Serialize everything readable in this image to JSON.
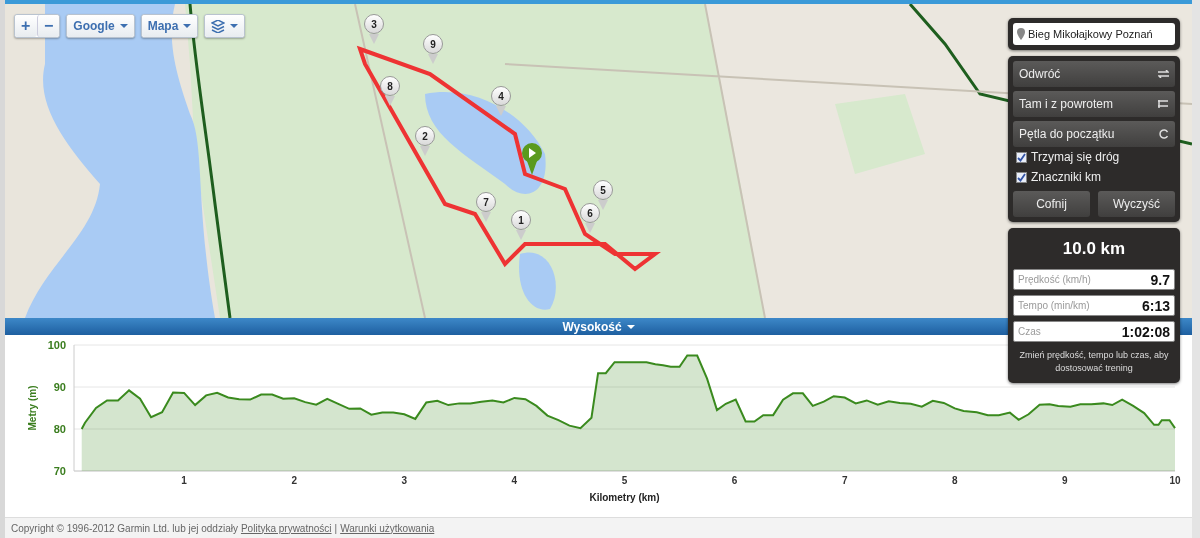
{
  "map": {
    "controls": [
      {
        "kind": "zoom",
        "labels": [
          "+",
          "−"
        ]
      },
      {
        "kind": "dropdown",
        "label": "Google"
      },
      {
        "kind": "dropdown",
        "label": "Mapa"
      },
      {
        "kind": "layers"
      }
    ],
    "km_markers": [
      "1",
      "2",
      "3",
      "4",
      "5",
      "6",
      "7",
      "8",
      "9"
    ],
    "route_panel": {
      "search": {
        "value": "Bieg Mikołajkowy Poznań"
      },
      "actions": [
        {
          "label": "Odwróć",
          "kind": "reverse"
        },
        {
          "label": "Tam i z powrotem",
          "kind": "outback"
        },
        {
          "label": "Pętla do początku",
          "kind": "loop"
        }
      ],
      "options": [
        {
          "label": "Trzymaj się dróg",
          "checked": true
        },
        {
          "label": "Znaczniki km",
          "checked": true
        }
      ],
      "buttons": [
        "Cofnij",
        "Wyczyść"
      ]
    },
    "stats": {
      "distance": "10.0 km",
      "fields": [
        {
          "label": "Prędkość (km/h)",
          "value": "9.7"
        },
        {
          "label": "Tempo (min/km)",
          "value": "6:13"
        },
        {
          "label": "Czas",
          "value": "1:02:08"
        }
      ],
      "note": "Zmień prędkość, tempo lub czas, aby dostosować trening"
    }
  },
  "chart_header": {
    "label": "Wysokość"
  },
  "chart_data": {
    "type": "area",
    "xlabel": "Kilometry (km)",
    "ylabel": "Metry (m)",
    "xlim": [
      0,
      10
    ],
    "ylim": [
      70,
      100
    ],
    "xticks": [
      1,
      2,
      3,
      4,
      5,
      6,
      7,
      8,
      9,
      10
    ],
    "yticks": [
      70,
      80,
      90,
      100
    ],
    "x": [
      0.07,
      0.1,
      0.2,
      0.3,
      0.4,
      0.5,
      0.6,
      0.7,
      0.8,
      0.9,
      1.0,
      1.1,
      1.2,
      1.3,
      1.4,
      1.5,
      1.6,
      1.7,
      1.8,
      1.9,
      2.0,
      2.1,
      2.2,
      2.3,
      2.4,
      2.5,
      2.6,
      2.7,
      2.8,
      2.9,
      3.0,
      3.1,
      3.2,
      3.3,
      3.4,
      3.5,
      3.6,
      3.7,
      3.8,
      3.9,
      4.0,
      4.1,
      4.2,
      4.3,
      4.4,
      4.5,
      4.6,
      4.7,
      4.73,
      4.76,
      4.83,
      4.91,
      5.2,
      5.28,
      5.35,
      5.42,
      5.5,
      5.57,
      5.66,
      5.75,
      5.84,
      5.92,
      6.01,
      6.1,
      6.18,
      6.26,
      6.35,
      6.44,
      6.53,
      6.62,
      6.71,
      6.81,
      6.9,
      7.0,
      7.1,
      7.2,
      7.3,
      7.4,
      7.5,
      7.6,
      7.7,
      7.8,
      7.9,
      8.0,
      8.08,
      8.2,
      8.3,
      8.4,
      8.5,
      8.58,
      8.67,
      8.77,
      8.86,
      8.94,
      9.05,
      9.14,
      9.24,
      9.35,
      9.43,
      9.52,
      9.62,
      9.72,
      9.81,
      9.85,
      9.88,
      9.95,
      10.0
    ],
    "series": [
      {
        "color": "#3a8a1e",
        "values": [
          80,
          81.5,
          85,
          86.8,
          86.8,
          89.2,
          87.2,
          82.8,
          84,
          88.7,
          88.6,
          85.7,
          88,
          88.6,
          87.5,
          87.1,
          87,
          88.2,
          88.2,
          87.2,
          87.3,
          86.4,
          85.8,
          87.2,
          86,
          84.8,
          84.9,
          83.4,
          83.9,
          83.9,
          83.5,
          82.4,
          86.3,
          86.7,
          85.7,
          86.1,
          86.1,
          86.5,
          86.8,
          86.3,
          87.4,
          87.1,
          85.5,
          83.2,
          82.1,
          80.8,
          80.2,
          82.7,
          88,
          93.3,
          93.3,
          95.9,
          95.9,
          95.4,
          95.2,
          94.8,
          94.8,
          97.5,
          97.5,
          92,
          84.5,
          86,
          87,
          81.8,
          81.8,
          83.3,
          83.3,
          87,
          88.5,
          88.5,
          85.5,
          86.5,
          87.8,
          87.5,
          86.1,
          86.8,
          85.8,
          86.6,
          86.2,
          86,
          85.3,
          86.7,
          86.2,
          84.9,
          84.3,
          84,
          83.3,
          83.3,
          83.9,
          82.2,
          83.5,
          85.8,
          85.9,
          85.5,
          85.3,
          85.9,
          85.9,
          86.1,
          85.7,
          87,
          85.5,
          83.8,
          81,
          81,
          82.1,
          82.1,
          80.2
        ]
      }
    ]
  },
  "footer": {
    "copyright": "Copyright © 1996-2012 Garmin Ltd. lub jej oddziały",
    "links": [
      "Polityka prywatności",
      "Warunki użytkowania"
    ],
    "separator": "|"
  }
}
